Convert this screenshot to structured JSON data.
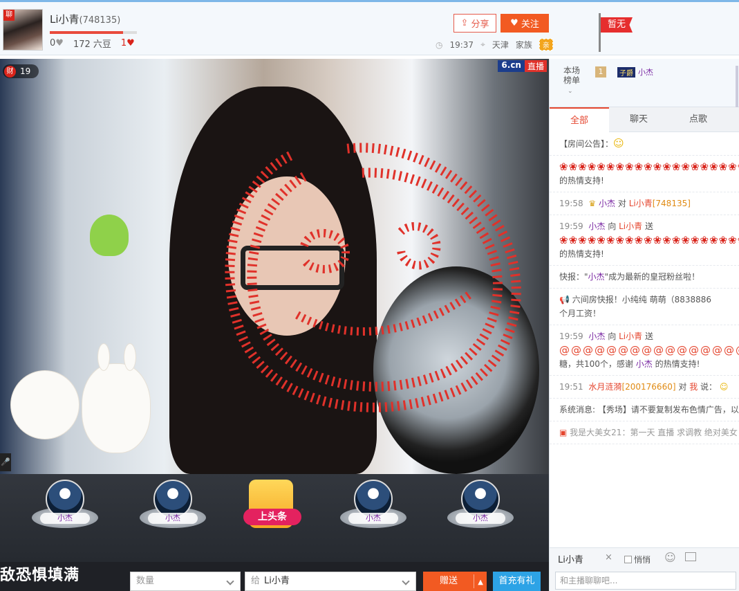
{
  "header": {
    "host_name": "Li小青",
    "room_id": "(748135)",
    "avatar_badge": "聊",
    "level_progress": 0.84,
    "stat_zero": "0",
    "liudou": "172 六豆",
    "hearts": "1",
    "share_label": "分享",
    "follow_label": "关注",
    "time": "19:37",
    "city": "天津",
    "family_label": "家族",
    "family_tag": "亲",
    "flag_text": "暂无"
  },
  "video": {
    "fortune_icon": "财",
    "fortune_value": "19",
    "brand_a": "6.cn",
    "brand_b": "直播"
  },
  "ranking": {
    "items": [
      {
        "name": "小杰"
      },
      {
        "name": "小杰"
      },
      {
        "name": "小杰"
      },
      {
        "name": "小杰"
      }
    ],
    "headline_label": "上头条"
  },
  "giftbar": {
    "marquee": "敌恐惧填满",
    "qty_placeholder": "数量",
    "to_prefix": "给",
    "to_name": "Li小青",
    "give_label": "赠送",
    "recharge_label": "首充有礼"
  },
  "panel": {
    "rank_label": "本场榜单",
    "rank_num": "1",
    "rank_tag": "子爵",
    "rank_user": "小杰",
    "tabs": [
      "全部",
      "聊天",
      "点歌"
    ],
    "notice": "【房间公告】：",
    "msg1_tail": "的热情支持!",
    "msg2_time": "19:58",
    "msg2_user": "小杰",
    "msg2_mid": "对",
    "msg2_target": "Li小青",
    "msg2_rid": "[748135]",
    "msg3_time": "19:59",
    "msg3_user": "小杰",
    "msg3_mid": "向",
    "msg3_target": "Li小青",
    "msg3_send": "送",
    "msg3_tail": "的热情支持!",
    "news1": "快报：\"",
    "news1_user": "小杰",
    "news1_tail": "\"成为最新的皇冠粉丝啦！",
    "news2": "六间房快报！",
    "news2_users": "小纯纯 萌萌",
    "news2_rid": "（8838886",
    "news2_tail": "个月工资！",
    "msg4_time": "19:59",
    "msg4_user": "小杰",
    "msg4_mid": "向",
    "msg4_target": "Li小青",
    "msg4_send": "送",
    "msg4_tail_a": "糖，共100个，感谢",
    "msg4_tail_user": "小杰",
    "msg4_tail_b": "的热情支持!",
    "msg5_time": "19:51",
    "msg5_user": "水月涟漪",
    "msg5_rid": "[200176660]",
    "msg5_mid": "对",
    "msg5_target": "我",
    "msg5_say": "说：",
    "sys": "系统消息:",
    "sys_tag": "【秀场】",
    "sys_tail": "请不要复制发布色情广告，以",
    "last_line": "我是大美女21：第一天 直播 求调教 绝对美女",
    "chat_target": "Li小青",
    "chat_close": "×",
    "private_label": "悄悄",
    "chat_placeholder": "和主播聊聊吧..."
  },
  "colors": {
    "accent": "#f25a22",
    "link_red": "#e5462f",
    "user_purple": "#7a28a3",
    "recharge_blue": "#2da3e6"
  }
}
